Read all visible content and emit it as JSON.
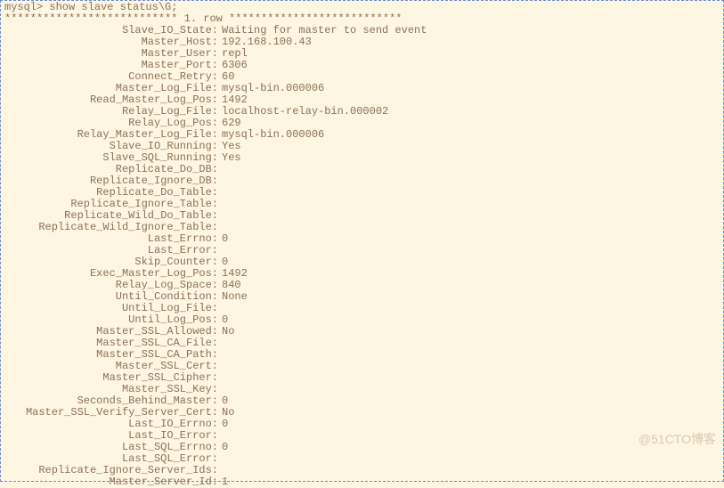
{
  "prompt": "mysql> show slave status\\G;",
  "row_header": "*************************** 1. row ***************************",
  "rows": [
    {
      "label": "Slave_IO_State",
      "value": "Waiting for master to send event"
    },
    {
      "label": "Master_Host",
      "value": "192.168.100.43"
    },
    {
      "label": "Master_User",
      "value": "repl"
    },
    {
      "label": "Master_Port",
      "value": "6306"
    },
    {
      "label": "Connect_Retry",
      "value": "60"
    },
    {
      "label": "Master_Log_File",
      "value": "mysql-bin.000006"
    },
    {
      "label": "Read_Master_Log_Pos",
      "value": "1492"
    },
    {
      "label": "Relay_Log_File",
      "value": "localhost-relay-bin.000002"
    },
    {
      "label": "Relay_Log_Pos",
      "value": "629"
    },
    {
      "label": "Relay_Master_Log_File",
      "value": "mysql-bin.000006"
    },
    {
      "label": "Slave_IO_Running",
      "value": "Yes"
    },
    {
      "label": "Slave_SQL_Running",
      "value": "Yes"
    },
    {
      "label": "Replicate_Do_DB",
      "value": ""
    },
    {
      "label": "Replicate_Ignore_DB",
      "value": ""
    },
    {
      "label": "Replicate_Do_Table",
      "value": ""
    },
    {
      "label": "Replicate_Ignore_Table",
      "value": ""
    },
    {
      "label": "Replicate_Wild_Do_Table",
      "value": ""
    },
    {
      "label": "Replicate_Wild_Ignore_Table",
      "value": ""
    },
    {
      "label": "Last_Errno",
      "value": "0"
    },
    {
      "label": "Last_Error",
      "value": ""
    },
    {
      "label": "Skip_Counter",
      "value": "0"
    },
    {
      "label": "Exec_Master_Log_Pos",
      "value": "1492"
    },
    {
      "label": "Relay_Log_Space",
      "value": "840"
    },
    {
      "label": "Until_Condition",
      "value": "None"
    },
    {
      "label": "Until_Log_File",
      "value": ""
    },
    {
      "label": "Until_Log_Pos",
      "value": "0"
    },
    {
      "label": "Master_SSL_Allowed",
      "value": "No"
    },
    {
      "label": "Master_SSL_CA_File",
      "value": ""
    },
    {
      "label": "Master_SSL_CA_Path",
      "value": ""
    },
    {
      "label": "Master_SSL_Cert",
      "value": ""
    },
    {
      "label": "Master_SSL_Cipher",
      "value": ""
    },
    {
      "label": "Master_SSL_Key",
      "value": ""
    },
    {
      "label": "Seconds_Behind_Master",
      "value": "0"
    },
    {
      "label": "Master_SSL_Verify_Server_Cert",
      "value": "No"
    },
    {
      "label": "Last_IO_Errno",
      "value": "0"
    },
    {
      "label": "Last_IO_Error",
      "value": ""
    },
    {
      "label": "Last_SQL_Errno",
      "value": "0"
    },
    {
      "label": "Last_SQL_Error",
      "value": ""
    },
    {
      "label": "Replicate_Ignore_Server_Ids",
      "value": ""
    },
    {
      "label": "Master_Server_Id",
      "value": "1"
    }
  ],
  "watermark": "@51CTO博客"
}
